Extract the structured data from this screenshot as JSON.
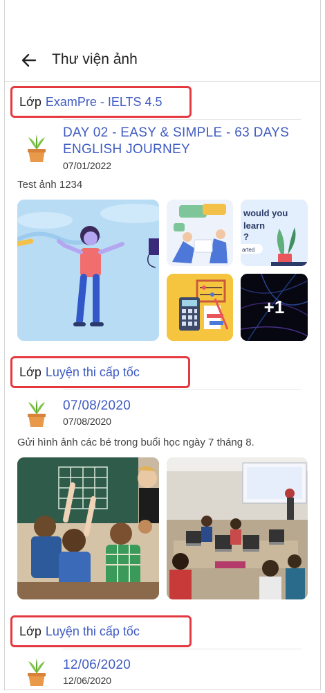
{
  "header": {
    "title": "Thư viện ảnh"
  },
  "class_prefix": "Lớp",
  "sections": [
    {
      "class_name": "ExamPre - IELTS 4.5",
      "post": {
        "title": "DAY 02 - EASY & SIMPLE - 63 DAYS ENGLISH JOURNEY",
        "date": "07/01/2022",
        "description": "Test ảnh 1234",
        "more_count": "+1"
      }
    },
    {
      "class_name": "Luyện thi cấp tốc",
      "post": {
        "title": "07/08/2020",
        "date": "07/08/2020",
        "description": "Gửi hình ảnh các bé trong buổi học ngày 7 tháng 8."
      }
    },
    {
      "class_name": "Luyện thi cấp tốc",
      "post": {
        "title": "12/06/2020",
        "date": "12/06/2020"
      }
    }
  ],
  "thumb_text": {
    "would_you": "would you",
    "learn": "learn",
    "q": "?",
    "started": "arted"
  },
  "colors": {
    "accent": "#3f5bc2",
    "highlight": "#e53940"
  }
}
